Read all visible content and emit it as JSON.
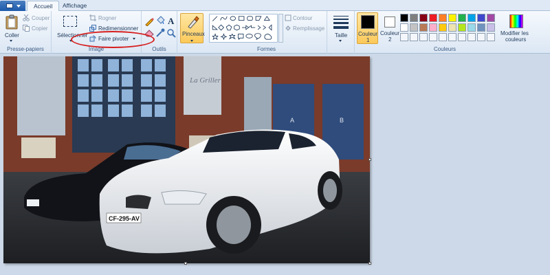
{
  "tabs": {
    "home": "Accueil",
    "view": "Affichage"
  },
  "clipboard": {
    "paste": "Coller",
    "cut": "Couper",
    "copy": "Copier",
    "group": "Presse-papiers"
  },
  "image": {
    "select": "Sélectionner",
    "crop": "Rogner",
    "resize": "Redimensionner",
    "rotate": "Faire pivoter",
    "group": "Image"
  },
  "tools": {
    "group": "Outils"
  },
  "brushes": {
    "label": "Pinceaux"
  },
  "shapes": {
    "outline": "Contour",
    "fill": "Remplissage",
    "group": "Formes"
  },
  "size": {
    "label": "Taille"
  },
  "colors": {
    "color1": "Couleur",
    "color1_index": "1",
    "color2": "Couleur",
    "color2_index": "2",
    "edit": "Modifier les",
    "edit2": "couleurs",
    "group": "Couleurs",
    "color1_value": "#000000",
    "color2_value": "#ffffff",
    "palette_row1": [
      "#000000",
      "#7f7f7f",
      "#880015",
      "#ed1c24",
      "#ff7f27",
      "#fff200",
      "#22b14c",
      "#00a2e8",
      "#3f48cc",
      "#a349a4"
    ],
    "palette_row2": [
      "#ffffff",
      "#c3c3c3",
      "#b97a57",
      "#ffaec9",
      "#ffc90e",
      "#efe4b0",
      "#b5e61d",
      "#99d9ea",
      "#7092be",
      "#c8bfe7"
    ]
  },
  "photo": {
    "plate_front": "CF-295-AV",
    "plate_back": "",
    "sign_text": "La Griller",
    "door_a": "A",
    "door_b": "B"
  }
}
